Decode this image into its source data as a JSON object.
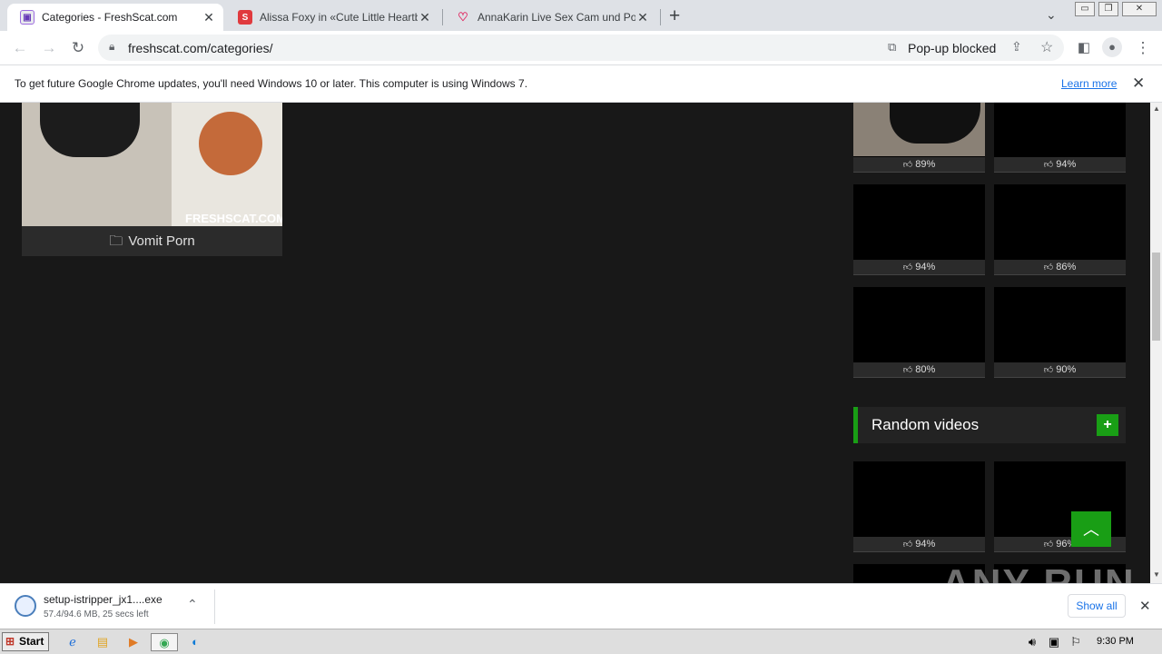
{
  "browser": {
    "tabs": [
      {
        "title": "Categories - FreshScat.com",
        "active": true
      },
      {
        "title": "Alissa Foxy in «Cute Little Heartbrea",
        "active": false
      },
      {
        "title": "AnnaKarin Live Sex Cam und Porno",
        "active": false
      }
    ],
    "url": "freshscat.com/categories/",
    "popup_blocked": "Pop-up blocked",
    "new_tab": "+"
  },
  "infobar": {
    "message": "To get future Google Chrome updates, you'll need Windows 10 or later. This computer is using Windows 7.",
    "learn_more": "Learn more"
  },
  "page": {
    "category_card": {
      "label": "Vomit Porn",
      "watermark": "FRESHSCAT.COM"
    },
    "sidebar_ratings_top": [
      "89%",
      "94%",
      "94%",
      "86%",
      "80%",
      "90%"
    ],
    "random_videos_title": "Random videos",
    "random_plus": "+",
    "random_ratings": [
      "94%",
      "96%"
    ],
    "back_to_top": "^"
  },
  "watermark": "ANY RUN",
  "download": {
    "filename": "setup-istripper_jx1....exe",
    "status": "57.4/94.6 MB, 25 secs left",
    "show_all": "Show all"
  },
  "taskbar": {
    "start": "Start",
    "clock": "9:30 PM"
  }
}
